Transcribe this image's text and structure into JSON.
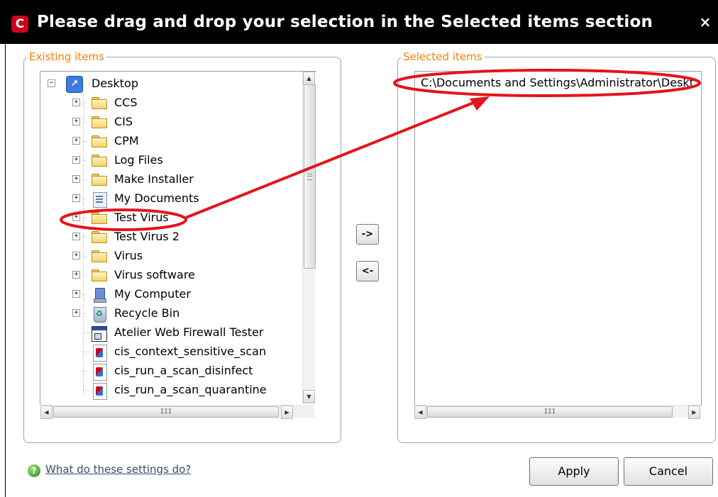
{
  "dialog": {
    "title": "Please drag and drop your selection in the Selected items section",
    "logo_letter": "C",
    "close_glyph": "×"
  },
  "existing_items": {
    "legend": "Existing items",
    "tree": [
      {
        "label": "Desktop",
        "icon": "desktop-icon",
        "expander": "−"
      },
      {
        "label": "CCS",
        "icon": "folder-icon",
        "expander": "+"
      },
      {
        "label": "CIS",
        "icon": "folder-icon",
        "expander": "+"
      },
      {
        "label": "CPM",
        "icon": "folder-icon",
        "expander": "+"
      },
      {
        "label": "Log Files",
        "icon": "folder-icon",
        "expander": "+"
      },
      {
        "label": "Make Installer",
        "icon": "folder-icon",
        "expander": "+"
      },
      {
        "label": "My Documents",
        "icon": "documents-icon",
        "expander": "+"
      },
      {
        "label": "Test Virus",
        "icon": "folder-icon",
        "expander": "+"
      },
      {
        "label": "Test Virus 2",
        "icon": "folder-icon",
        "expander": "+"
      },
      {
        "label": "Virus",
        "icon": "folder-icon",
        "expander": "+"
      },
      {
        "label": "Virus software",
        "icon": "folder-icon",
        "expander": "+"
      },
      {
        "label": "My Computer",
        "icon": "computer-icon",
        "expander": "+"
      },
      {
        "label": "Recycle Bin",
        "icon": "recycle-bin-icon",
        "expander": "+"
      },
      {
        "label": "Atelier Web Firewall Tester",
        "icon": "application-icon"
      },
      {
        "label": "cis_context_sensitive_scan",
        "icon": "scan-shortcut-icon"
      },
      {
        "label": "cis_run_a_scan_disinfect",
        "icon": "scan-shortcut-icon"
      },
      {
        "label": "cis_run_a_scan_quarantine",
        "icon": "scan-shortcut-icon"
      }
    ]
  },
  "selected_items": {
    "legend": "Selected items",
    "items": [
      "C:\\Documents and Settings\\Administrator\\Deskt"
    ]
  },
  "buttons": {
    "add": "->",
    "remove": "<-",
    "apply": "Apply",
    "cancel": "Cancel"
  },
  "help": {
    "icon_glyph": "?",
    "link_text": "What do these settings do?"
  },
  "scrollbar_glyphs": {
    "up": "▲",
    "down": "▼",
    "left": "◀",
    "right": "▶",
    "grip": "III"
  },
  "colors": {
    "titlebar": "#000000",
    "legend": "#ff7e00",
    "annotation": "#e4141b",
    "group_border": "#8fa6c3"
  }
}
